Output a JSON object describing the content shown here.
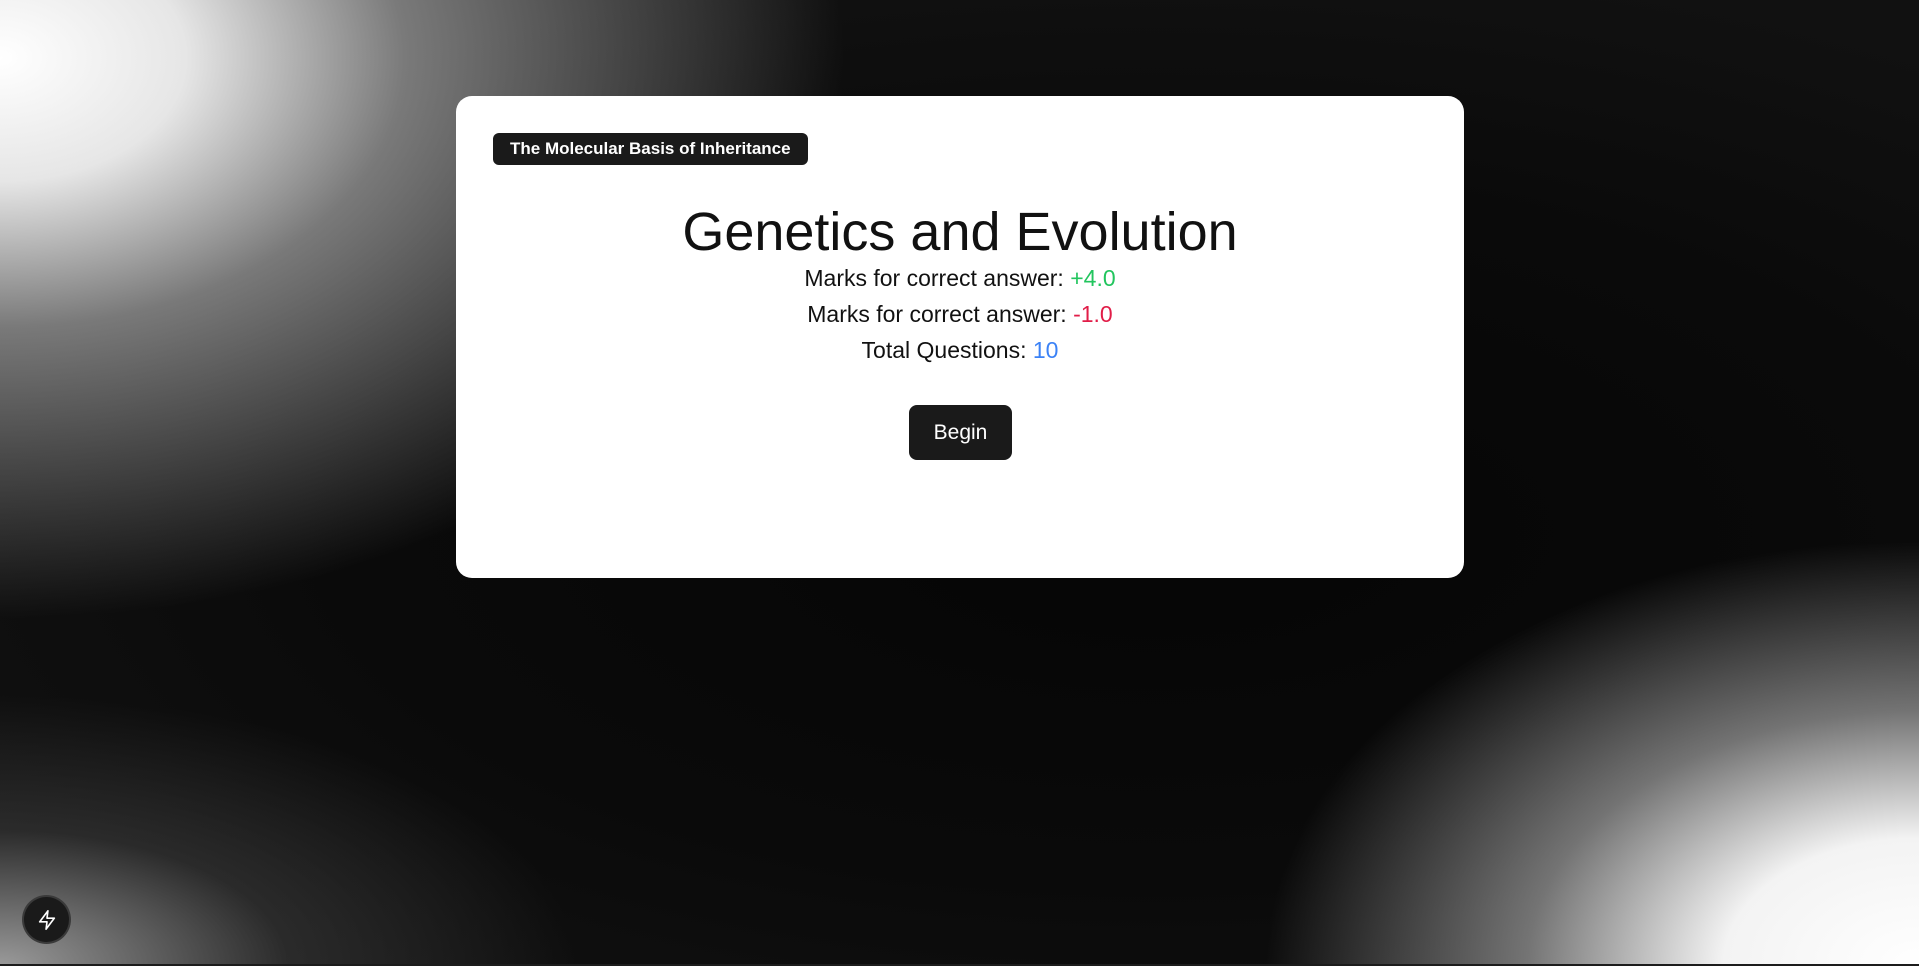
{
  "quiz": {
    "topic_tag": "The Molecular Basis of Inheritance",
    "title": "Genetics and Evolution",
    "lines": [
      {
        "label": "Marks for correct answer: ",
        "value": "+4.0"
      },
      {
        "label": "Marks for correct answer: ",
        "value": "-1.0"
      },
      {
        "label": "Total Questions: ",
        "value": "10"
      }
    ],
    "begin_label": "Begin"
  },
  "floating_button": {
    "icon": "lightning-bolt-icon"
  },
  "colors": {
    "positive": "#22c55e",
    "negative": "#e11d48",
    "total": "#3b82f6",
    "dark": "#1a1a1a"
  }
}
